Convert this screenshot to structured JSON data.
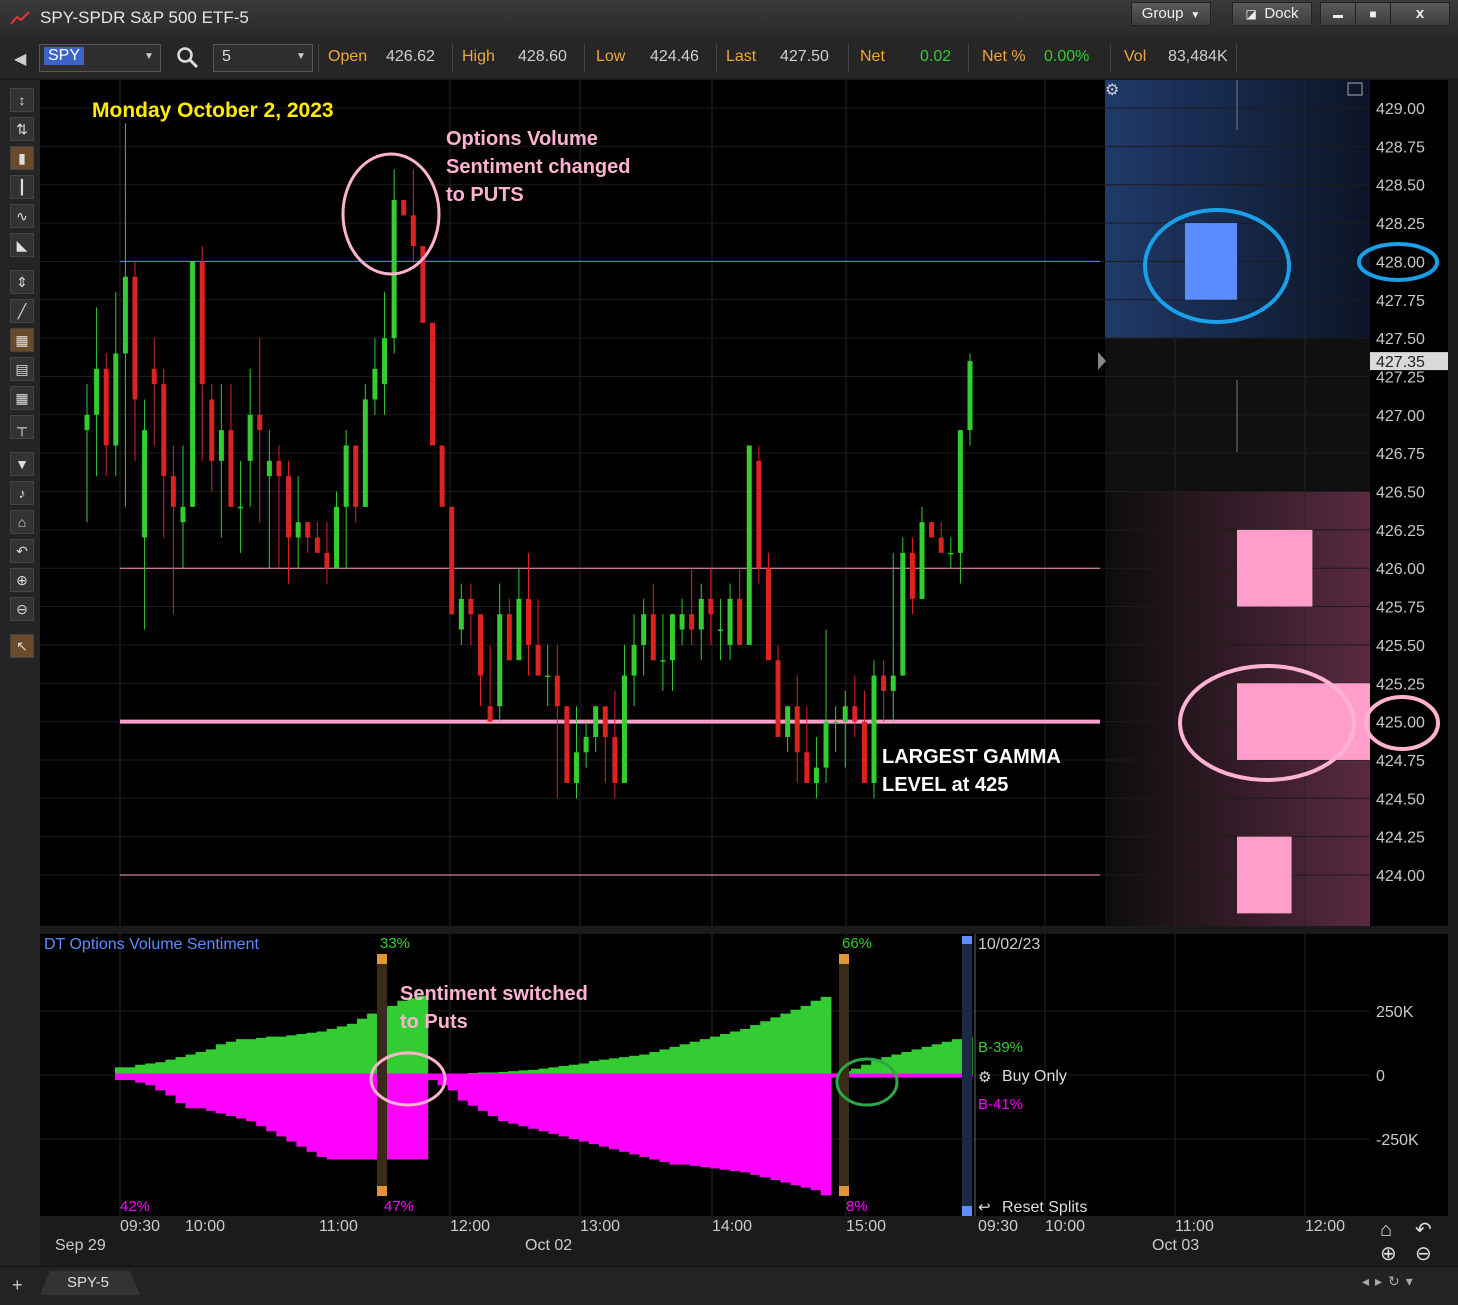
{
  "window": {
    "title": "SPY-SPDR S&P 500 ETF-5",
    "group_label": "Group",
    "dock_label": "Dock",
    "min_symbol": "▬",
    "max_symbol": "■",
    "close_symbol": "x"
  },
  "toolbar": {
    "symbol": "SPY",
    "interval": "5",
    "quote": [
      {
        "label": "Open",
        "value": "426.62",
        "color": "#cfcfcf"
      },
      {
        "label": "High",
        "value": "428.60",
        "color": "#cfcfcf"
      },
      {
        "label": "Low",
        "value": "424.46",
        "color": "#cfcfcf"
      },
      {
        "label": "Last",
        "value": "427.50",
        "color": "#cfcfcf"
      },
      {
        "label": "Net",
        "value": "0.02",
        "color": "#33cc33"
      },
      {
        "label": "Net %",
        "value": "0.00%",
        "color": "#33cc33"
      },
      {
        "label": "Vol",
        "value": "83,484K",
        "color": "#cfcfcf"
      }
    ]
  },
  "left_tools": [
    "crosshair-tool-icon",
    "move-tool-icon",
    "candle-style-icon",
    "bar-style-icon",
    "line-style-icon",
    "area-style-icon",
    "fit-vertical-icon",
    "draw-line-icon",
    "grid-icon",
    "table-icon",
    "grid-small-icon",
    "hline-icon",
    "pin-icon",
    "note-icon",
    "home-icon",
    "undo-icon",
    "zoom-in-icon",
    "zoom-out-icon",
    "pointer-icon"
  ],
  "annotations": {
    "date_label": "Monday October 2, 2023",
    "options_note": [
      "Options Volume",
      "Sentiment changed",
      "to PUTS"
    ],
    "gamma_note": [
      "LARGEST GAMMA",
      "LEVEL at 425"
    ],
    "sentiment_note": [
      "Sentiment switched",
      "to Puts"
    ],
    "colors": {
      "date": "#ffea00",
      "note": "#ffb3d1",
      "note_white": "#ffffff"
    }
  },
  "chart_data": [
    {
      "type": "candlestick",
      "title": "SPY-SPDR S&P 500 ETF-5",
      "ylim": [
        423.5,
        429.2
      ],
      "y_ticks": [
        "429.00",
        "428.75",
        "428.50",
        "428.25",
        "428.00",
        "427.75",
        "427.50",
        "427.25",
        "427.00",
        "426.75",
        "426.50",
        "426.25",
        "426.00",
        "425.75",
        "425.50",
        "425.25",
        "425.00",
        "424.75",
        "424.50",
        "424.25",
        "424.00"
      ],
      "last_price_label": "427.35",
      "horizontal_lines": [
        {
          "price": 428.0,
          "color": "#5b8dff",
          "width": 1
        },
        {
          "price": 426.0,
          "color": "#ff9ecb",
          "width": 1
        },
        {
          "price": 425.0,
          "color": "#ff9ecb",
          "width": 4
        },
        {
          "price": 424.0,
          "color": "#ff9ecb",
          "width": 1
        }
      ],
      "gamma_bars": [
        {
          "price_from": 427.75,
          "price_to": 428.25,
          "strength": 0.45,
          "color": "#5b8dff"
        },
        {
          "price_from": 425.75,
          "price_to": 426.25,
          "strength": 0.58,
          "color": "#ff9ecb"
        },
        {
          "price_from": 424.75,
          "price_to": 425.25,
          "strength": 1.0,
          "color": "#ff9ecb"
        },
        {
          "price_from": 423.75,
          "price_to": 424.25,
          "strength": 0.42,
          "color": "#ff9ecb"
        }
      ],
      "up_color": "#33cc33",
      "down_color": "#dd2222",
      "candles": [
        [
          426.9,
          427.2,
          426.3,
          427.0
        ],
        [
          427.0,
          427.7,
          426.6,
          427.3
        ],
        [
          427.3,
          427.4,
          426.6,
          426.8
        ],
        [
          426.8,
          427.8,
          426.6,
          427.4
        ],
        [
          427.4,
          428.9,
          426.4,
          427.9
        ],
        [
          427.9,
          428.0,
          426.7,
          427.1
        ],
        [
          426.2,
          427.1,
          425.6,
          426.9
        ],
        [
          427.3,
          427.5,
          426.8,
          427.2
        ],
        [
          427.2,
          427.3,
          426.2,
          426.6
        ],
        [
          426.6,
          426.8,
          425.7,
          426.4
        ],
        [
          426.3,
          426.8,
          426.0,
          426.4
        ],
        [
          426.4,
          428.0,
          426.4,
          428.0
        ],
        [
          428.0,
          428.1,
          426.7,
          427.2
        ],
        [
          427.1,
          427.2,
          426.5,
          426.7
        ],
        [
          426.7,
          427.2,
          426.2,
          426.9
        ],
        [
          426.9,
          427.2,
          426.4,
          426.4
        ],
        [
          426.4,
          426.7,
          426.1,
          426.4
        ],
        [
          426.7,
          427.3,
          426.4,
          427.0
        ],
        [
          427.0,
          427.5,
          426.3,
          426.9
        ],
        [
          426.6,
          426.9,
          426.0,
          426.7
        ],
        [
          426.7,
          426.8,
          426.0,
          426.6
        ],
        [
          426.6,
          426.7,
          425.9,
          426.2
        ],
        [
          426.2,
          426.6,
          426.0,
          426.3
        ],
        [
          426.3,
          426.3,
          426.1,
          426.2
        ],
        [
          426.2,
          426.3,
          426.1,
          426.1
        ],
        [
          426.1,
          426.3,
          425.9,
          426.0
        ],
        [
          426.0,
          426.5,
          426.0,
          426.4
        ],
        [
          426.4,
          426.9,
          426.0,
          426.8
        ],
        [
          426.8,
          426.8,
          426.3,
          426.4
        ],
        [
          426.4,
          427.2,
          426.4,
          427.1
        ],
        [
          427.1,
          427.5,
          427.0,
          427.3
        ],
        [
          427.2,
          427.8,
          427.0,
          427.5
        ],
        [
          427.5,
          428.6,
          427.4,
          428.4
        ],
        [
          428.4,
          428.4,
          428.3,
          428.3
        ],
        [
          428.3,
          428.6,
          428.0,
          428.1
        ],
        [
          428.1,
          428.1,
          427.6,
          427.6
        ],
        [
          427.6,
          427.6,
          426.8,
          426.8
        ],
        [
          426.8,
          426.8,
          426.4,
          426.4
        ],
        [
          426.4,
          426.4,
          425.7,
          425.7
        ],
        [
          425.6,
          425.9,
          425.5,
          425.8
        ],
        [
          425.8,
          425.9,
          425.5,
          425.7
        ],
        [
          425.7,
          425.7,
          425.1,
          425.3
        ],
        [
          425.1,
          425.5,
          425.0,
          425.0
        ],
        [
          425.1,
          425.9,
          425.0,
          425.7
        ],
        [
          425.7,
          425.8,
          425.4,
          425.4
        ],
        [
          425.4,
          426.0,
          425.4,
          425.8
        ],
        [
          425.8,
          426.1,
          425.3,
          425.5
        ],
        [
          425.5,
          425.8,
          425.3,
          425.3
        ],
        [
          425.3,
          425.5,
          425.1,
          425.3
        ],
        [
          425.3,
          425.5,
          424.5,
          425.1
        ],
        [
          425.1,
          425.1,
          424.6,
          424.6
        ],
        [
          424.6,
          425.1,
          424.5,
          424.8
        ],
        [
          424.8,
          425.0,
          424.7,
          424.9
        ],
        [
          424.9,
          425.1,
          424.8,
          425.1
        ],
        [
          425.1,
          425.1,
          424.6,
          424.9
        ],
        [
          424.9,
          425.2,
          424.5,
          424.6
        ],
        [
          424.6,
          425.5,
          424.6,
          425.3
        ],
        [
          425.3,
          425.7,
          425.1,
          425.5
        ],
        [
          425.5,
          425.8,
          425.3,
          425.7
        ],
        [
          425.7,
          425.9,
          425.4,
          425.4
        ],
        [
          425.4,
          425.7,
          425.2,
          425.4
        ],
        [
          425.4,
          425.7,
          425.2,
          425.7
        ],
        [
          425.6,
          425.8,
          425.5,
          425.7
        ],
        [
          425.7,
          426.0,
          425.5,
          425.6
        ],
        [
          425.6,
          425.9,
          425.4,
          425.8
        ],
        [
          425.8,
          426.0,
          425.5,
          425.7
        ],
        [
          425.6,
          425.8,
          425.4,
          425.6
        ],
        [
          425.5,
          425.9,
          425.4,
          425.8
        ],
        [
          425.8,
          426.0,
          425.5,
          425.5
        ],
        [
          425.5,
          426.8,
          425.5,
          426.8
        ],
        [
          426.7,
          426.8,
          425.9,
          426.0
        ],
        [
          426.0,
          426.1,
          425.4,
          425.4
        ],
        [
          425.4,
          425.5,
          424.9,
          424.9
        ],
        [
          424.9,
          425.1,
          424.8,
          425.1
        ],
        [
          425.1,
          425.3,
          424.6,
          424.8
        ],
        [
          424.8,
          425.1,
          424.6,
          424.6
        ],
        [
          424.6,
          424.9,
          424.5,
          424.7
        ],
        [
          424.7,
          425.6,
          424.6,
          425.0
        ],
        [
          425.0,
          425.1,
          424.8,
          425.0
        ],
        [
          425.0,
          425.2,
          424.7,
          425.1
        ],
        [
          425.1,
          425.3,
          424.9,
          425.0
        ],
        [
          425.0,
          425.2,
          424.6,
          424.6
        ],
        [
          424.6,
          425.4,
          424.5,
          425.3
        ],
        [
          425.3,
          425.4,
          425.0,
          425.2
        ],
        [
          425.2,
          426.1,
          425.0,
          425.3
        ],
        [
          425.3,
          426.2,
          425.3,
          426.1
        ],
        [
          426.1,
          426.2,
          425.7,
          425.8
        ],
        [
          425.8,
          426.4,
          425.8,
          426.3
        ],
        [
          426.3,
          426.3,
          426.2,
          426.2
        ],
        [
          426.2,
          426.3,
          426.1,
          426.1
        ],
        [
          426.1,
          426.2,
          426.0,
          426.1
        ],
        [
          426.1,
          426.9,
          425.9,
          426.9
        ],
        [
          426.9,
          427.4,
          426.8,
          427.35
        ]
      ]
    },
    {
      "type": "area",
      "title": "DT Options Volume Sentiment",
      "ylim": [
        -400000,
        350000
      ],
      "y_ticks": [
        "250K",
        "0",
        "-250K"
      ],
      "date_label": "10/02/23",
      "positive_color": "#33cc33",
      "negative_color": "#ff00ff",
      "segments": [
        {
          "start_pct_label": "33%",
          "end_pct_label": "47%",
          "start_pct_color": "#33cc33",
          "end_pct_color": "#ff00ff"
        },
        {
          "start_pct_label": "66%",
          "end_pct_label": "8%",
          "start_pct_color": "#33cc33",
          "end_pct_color": "#ff00ff"
        }
      ],
      "first_label": "42%",
      "buy_pct": "B-39%",
      "sell_pct": "B-41%",
      "mode_label": "Buy Only",
      "reset_label": "Reset Splits",
      "positive_series": [
        30000,
        30000,
        40000,
        45000,
        50000,
        60000,
        70000,
        80000,
        90000,
        100000,
        120000,
        130000,
        140000,
        140000,
        145000,
        150000,
        150000,
        155000,
        160000,
        165000,
        170000,
        180000,
        190000,
        200000,
        220000,
        240000,
        260000,
        270000,
        290000,
        300000,
        310000,
        0,
        5000,
        5000,
        5000,
        8000,
        10000,
        10000,
        12000,
        15000,
        18000,
        20000,
        25000,
        30000,
        35000,
        40000,
        45000,
        55000,
        60000,
        65000,
        70000,
        75000,
        80000,
        90000,
        100000,
        110000,
        120000,
        130000,
        140000,
        150000,
        160000,
        170000,
        180000,
        195000,
        210000,
        225000,
        240000,
        255000,
        270000,
        290000,
        305000,
        0,
        15000,
        25000,
        40000,
        60000,
        70000,
        80000,
        90000,
        100000,
        110000,
        120000,
        130000,
        140000,
        150000
      ],
      "negative_series": [
        -20000,
        -20000,
        -30000,
        -40000,
        -60000,
        -80000,
        -110000,
        -130000,
        -130000,
        -140000,
        -150000,
        -160000,
        -170000,
        -180000,
        -200000,
        -220000,
        -240000,
        -260000,
        -280000,
        -300000,
        -320000,
        -330000,
        -330000,
        -330000,
        -330000,
        -330000,
        -330000,
        -330000,
        -330000,
        -330000,
        -330000,
        -20000,
        -40000,
        -60000,
        -100000,
        -120000,
        -140000,
        -160000,
        -180000,
        -190000,
        -200000,
        -210000,
        -220000,
        -230000,
        -240000,
        -250000,
        -260000,
        -270000,
        -280000,
        -290000,
        -300000,
        -310000,
        -320000,
        -330000,
        -340000,
        -350000,
        -350000,
        -355000,
        -360000,
        -365000,
        -370000,
        -375000,
        -380000,
        -390000,
        -400000,
        -410000,
        -420000,
        -430000,
        -440000,
        -450000,
        -470000,
        -10000,
        -10000,
        -10000,
        -10000,
        -10000,
        -10000,
        -10000,
        -10000,
        -10000,
        -10000,
        -10000,
        -10000,
        -10000,
        -10000
      ]
    }
  ],
  "time_axis": {
    "ticks": [
      "09:30",
      "10:00",
      "11:00",
      "12:00",
      "13:00",
      "14:00",
      "15:00",
      "09:30",
      "10:00",
      "11:00",
      "12:00"
    ],
    "dates": [
      "Sep 29",
      "Oct 02",
      "Oct 03"
    ]
  },
  "bottom": {
    "tab_label": "SPY-5",
    "add_symbol": "+"
  }
}
